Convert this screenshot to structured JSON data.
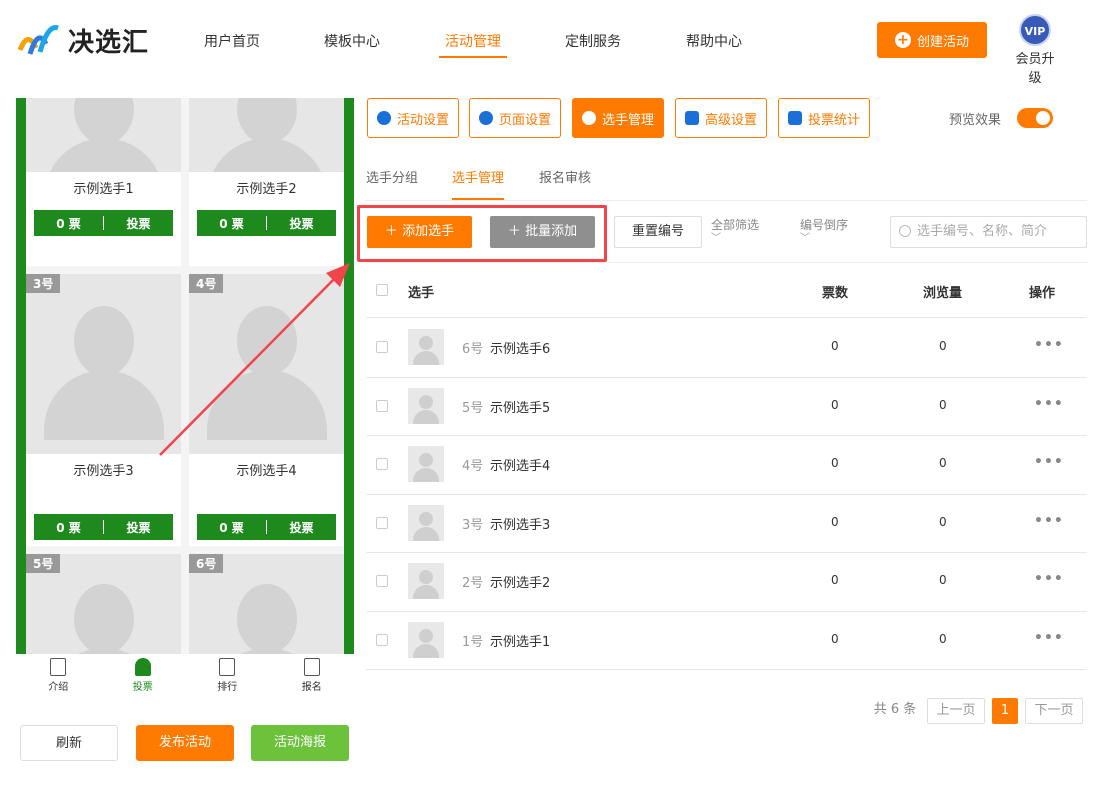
{
  "header": {
    "logo_text": "决选汇",
    "nav": [
      "用户首页",
      "模板中心",
      "活动管理",
      "定制服务",
      "帮助中心"
    ],
    "active_nav": "活动管理",
    "create_button": "创建活动",
    "vip_badge": "VIP",
    "vip_label": "会员升级"
  },
  "preview": {
    "cards": [
      {
        "tag": "",
        "name": "示例选手1",
        "votes": "0 票",
        "vote_label": "投票"
      },
      {
        "tag": "",
        "name": "示例选手2",
        "votes": "0 票",
        "vote_label": "投票"
      },
      {
        "tag": "3号",
        "name": "示例选手3",
        "votes": "0 票",
        "vote_label": "投票"
      },
      {
        "tag": "4号",
        "name": "示例选手4",
        "votes": "0 票",
        "vote_label": "投票"
      },
      {
        "tag": "5号",
        "name": "",
        "votes": "",
        "vote_label": ""
      },
      {
        "tag": "6号",
        "name": "",
        "votes": "",
        "vote_label": ""
      }
    ],
    "tabbar": [
      "介绍",
      "投票",
      "排行",
      "报名"
    ],
    "active_tab": "投票",
    "accent_color": "#1e8a1e"
  },
  "bottom_buttons": {
    "refresh": "刷新",
    "publish": "发布活动",
    "poster": "活动海报"
  },
  "toolbar": {
    "buttons": [
      "活动设置",
      "页面设置",
      "选手管理",
      "高级设置",
      "投票统计"
    ],
    "active": "选手管理",
    "preview_label": "预览效果",
    "preview_on": true
  },
  "subtabs": [
    "选手分组",
    "选手管理",
    "报名审核"
  ],
  "active_subtab": "选手管理",
  "actions": {
    "add": "添加选手",
    "batch_add": "批量添加",
    "reset_number": "重置编号",
    "filter": "全部筛选",
    "sort": "编号倒序",
    "search_placeholder": "选手编号、名称、简介"
  },
  "table": {
    "headers": {
      "player": "选手",
      "votes": "票数",
      "views": "浏览量",
      "ops": "操作"
    },
    "rows": [
      {
        "num": "6号",
        "name": "示例选手6",
        "votes": "0",
        "views": "0",
        "ops": "•••"
      },
      {
        "num": "5号",
        "name": "示例选手5",
        "votes": "0",
        "views": "0",
        "ops": "•••"
      },
      {
        "num": "4号",
        "name": "示例选手4",
        "votes": "0",
        "views": "0",
        "ops": "•••"
      },
      {
        "num": "3号",
        "name": "示例选手3",
        "votes": "0",
        "views": "0",
        "ops": "•••"
      },
      {
        "num": "2号",
        "name": "示例选手2",
        "votes": "0",
        "views": "0",
        "ops": "•••"
      },
      {
        "num": "1号",
        "name": "示例选手1",
        "votes": "0",
        "views": "0",
        "ops": "•••"
      }
    ]
  },
  "pagination": {
    "total": "共 6 条",
    "prev": "上一页",
    "current": "1",
    "next": "下一页"
  },
  "colors": {
    "brand_orange": "#ff7a00",
    "highlight_red": "#f0454b"
  }
}
